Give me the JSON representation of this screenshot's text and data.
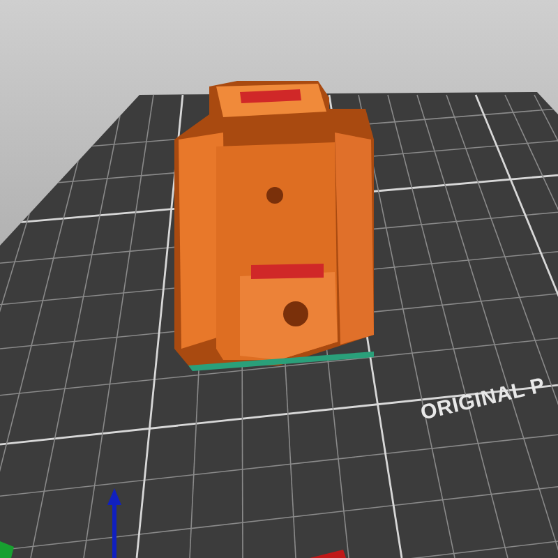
{
  "bed": {
    "label": "ORIGINAL P"
  }
}
